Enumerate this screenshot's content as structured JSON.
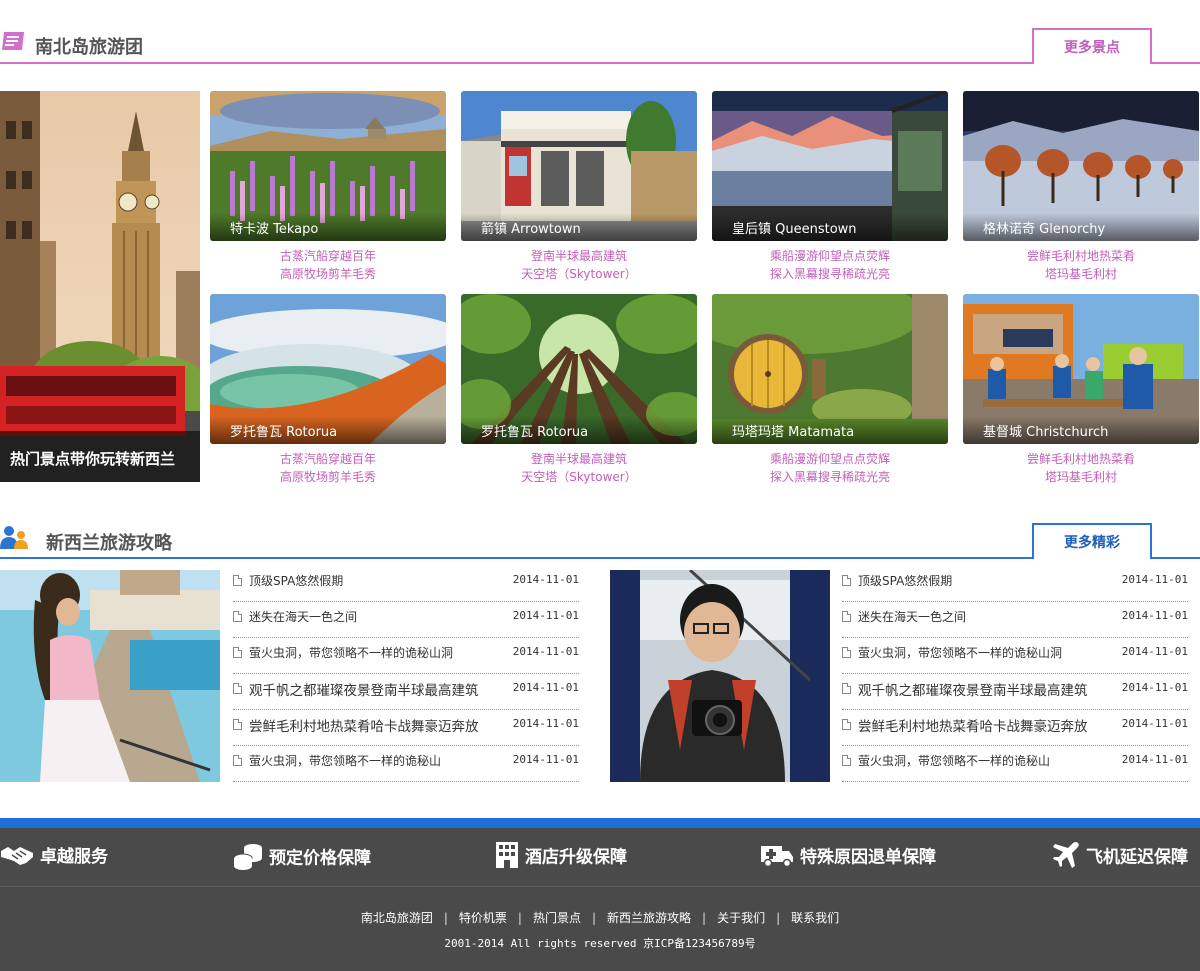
{
  "section1": {
    "title": "南北岛旅游团",
    "more_label": "更多景点",
    "accent": "#d36fc9",
    "feature_caption": "热门景点带你玩转新西兰",
    "tiles": [
      {
        "name": "特卡波 Tekapo",
        "line1": "古蒸汽船穿越百年",
        "line2": "高原牧场剪羊毛秀"
      },
      {
        "name": "箭镇 Arrowtown",
        "line1": "登南半球最高建筑",
        "line2": "天空塔（Skytower）"
      },
      {
        "name": "皇后镇 Queenstown",
        "line1": "乘船漫游仰望点点荧辉",
        "line2": "探入黑幕搜寻稀疏光亮"
      },
      {
        "name": "格林诺奇 Glenorchy",
        "line1": "尝鲜毛利村地热菜肴",
        "line2": "塔玛基毛利村"
      },
      {
        "name": "罗托鲁瓦 Rotorua",
        "line1": "古蒸汽船穿越百年",
        "line2": "高原牧场剪羊毛秀"
      },
      {
        "name": "罗托鲁瓦 Rotorua",
        "line1": "登南半球最高建筑",
        "line2": "天空塔（Skytower）"
      },
      {
        "name": "玛塔玛塔 Matamata",
        "line1": "乘船漫游仰望点点荧辉",
        "line2": "探入黑幕搜寻稀疏光亮"
      },
      {
        "name": "基督城 Christchurch",
        "line1": "尝鲜毛利村地热菜肴",
        "line2": "塔玛基毛利村"
      }
    ]
  },
  "section2": {
    "title": "新西兰旅游攻略",
    "more_label": "更多精彩",
    "accent": "#2a74d4",
    "left_list": [
      {
        "title": "顶级SPA悠然假期",
        "date": "2014-11-01"
      },
      {
        "title": "迷失在海天一色之间",
        "date": "2014-11-01"
      },
      {
        "title": "萤火虫洞，带您领略不一样的诡秘山洞",
        "date": "2014-11-01"
      },
      {
        "title": "观千帆之都璀璨夜景登南半球最高建筑",
        "date": "2014-11-01"
      },
      {
        "title": "尝鲜毛利村地热菜肴哈卡战舞豪迈奔放",
        "date": "2014-11-01"
      },
      {
        "title": "萤火虫洞，带您领略不一样的诡秘山",
        "date": "2014-11-01"
      }
    ],
    "right_list": [
      {
        "title": "顶级SPA悠然假期",
        "date": "2014-11-01"
      },
      {
        "title": "迷失在海天一色之间",
        "date": "2014-11-01"
      },
      {
        "title": "萤火虫洞，带您领略不一样的诡秘山洞",
        "date": "2014-11-01"
      },
      {
        "title": "观千帆之都璀璨夜景登南半球最高建筑",
        "date": "2014-11-01"
      },
      {
        "title": "尝鲜毛利村地热菜肴哈卡战舞豪迈奔放",
        "date": "2014-11-01"
      },
      {
        "title": "萤火虫洞，带您领略不一样的诡秘山",
        "date": "2014-11-01"
      }
    ]
  },
  "guarantees": [
    {
      "label": "卓越服务",
      "icon": "handshake-icon"
    },
    {
      "label": "预定价格保障",
      "icon": "coins-icon"
    },
    {
      "label": "酒店升级保障",
      "icon": "hotel-icon"
    },
    {
      "label": "特殊原因退单保障",
      "icon": "ambulance-icon"
    },
    {
      "label": "飞机延迟保障",
      "icon": "airplane-icon"
    }
  ],
  "footer": {
    "links": [
      "南北岛旅游团",
      "特价机票",
      "热门景点",
      "新西兰旅游攻略",
      "关于我们",
      "联系我们"
    ],
    "copyright": "2001-2014 All rights reserved 京ICP备123456789号"
  }
}
